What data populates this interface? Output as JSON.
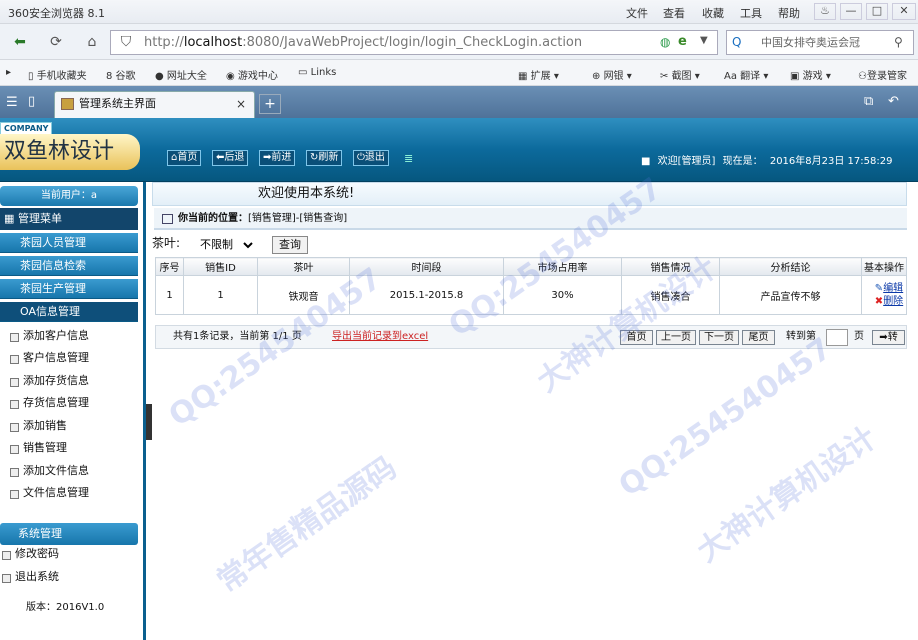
{
  "browser": {
    "app_title": "360安全浏览器 8.1",
    "menu": [
      "文件",
      "查看",
      "收藏",
      "工具",
      "帮助"
    ],
    "url_host": "localhost",
    "url_rest": ":8080/JavaWebProject/login/login_CheckLogin.action",
    "search_text": "中国女排夺奥运会冠",
    "favorites": [
      "手机收藏夹",
      "谷歌",
      "网址大全",
      "游戏中心",
      "Links"
    ],
    "tools": [
      "扩展",
      "网银",
      "截图",
      "翻译",
      "游戏",
      "登录管家"
    ],
    "tab_title": "管理系统主界面",
    "tab_close": "×",
    "new_tab": "+"
  },
  "header": {
    "company": "COMPANY",
    "logo": "双鱼林设计",
    "buttons": [
      "首页",
      "后退",
      "前进",
      "刷新",
      "退出"
    ],
    "welcome": "欢迎[管理员]",
    "now_label": "现在是：",
    "now": "2016年8月23日 17:58:29"
  },
  "sidebar": {
    "current_user": "当前用户：a",
    "menu_title": "管理菜单",
    "groups": [
      "茶园人员管理",
      "茶园信息检索",
      "茶园生产管理",
      "OA信息管理"
    ],
    "items": [
      "添加客户信息",
      "客户信息管理",
      "添加存货信息",
      "存货信息管理",
      "添加销售",
      "销售管理",
      "添加文件信息",
      "文件信息管理"
    ],
    "system": {
      "title": "系统管理",
      "items": [
        "修改密码",
        "退出系统"
      ]
    },
    "version": "版本：2016V1.0"
  },
  "main": {
    "welcome": "欢迎使用本系统!",
    "crumb_label": "你当前的位置：",
    "crumb_path": "[销售管理]-[销售查询]",
    "filter_label": "茶叶:",
    "filter_value": "不限制",
    "query_button": "查询",
    "table": {
      "columns": [
        "序号",
        "销售ID",
        "茶叶",
        "时间段",
        "市场占用率",
        "销售情况",
        "分析结论",
        "基本操作"
      ],
      "rows": [
        [
          "1",
          "1",
          "铁观音",
          "2015.1-2015.8",
          "30%",
          "销售凑合",
          "产品宣传不够"
        ]
      ],
      "ops": [
        "编辑",
        "删除"
      ]
    },
    "pager": {
      "summary": "共有1条记录，当前第 1/1 页",
      "export": "导出当前记录到excel",
      "buttons": [
        "首页",
        "上一页",
        "下一页",
        "尾页"
      ],
      "goto_label": "转到第",
      "page_unit": "页",
      "go": "转"
    }
  },
  "watermark": [
    "QQ:254540457",
    "大神计算机设计",
    "常年售精品源码"
  ]
}
